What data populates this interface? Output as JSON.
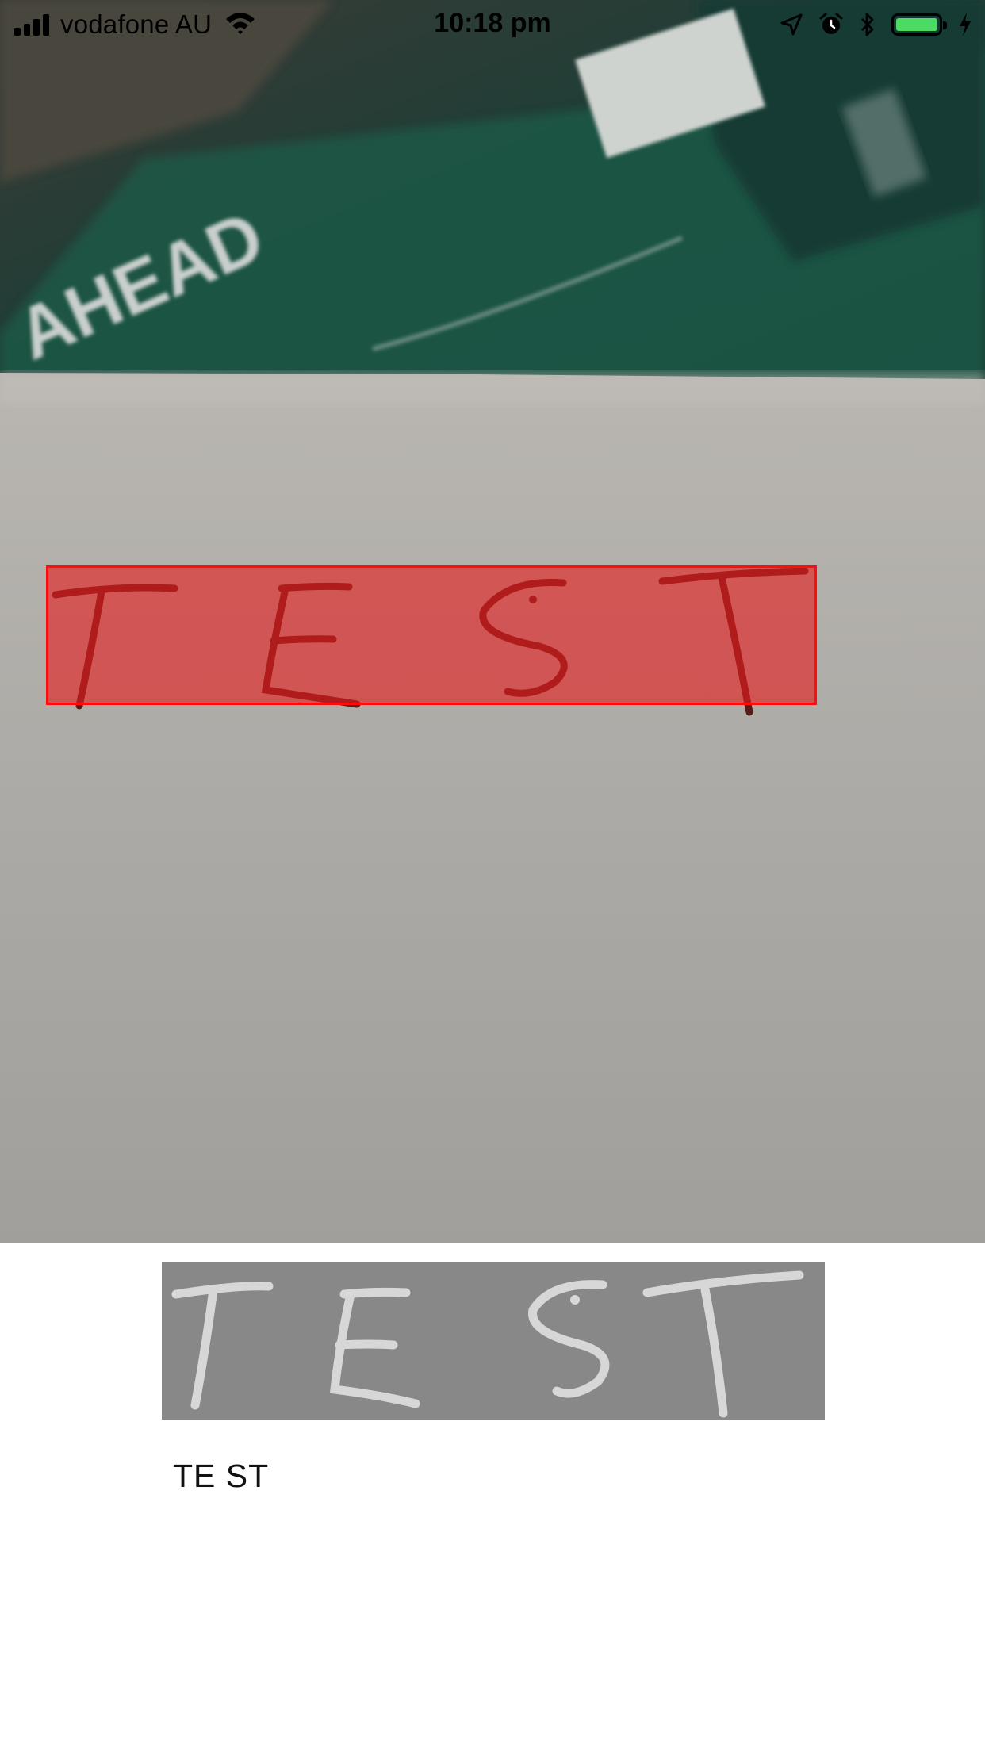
{
  "status_bar": {
    "carrier": "vodafone AU",
    "time": "10:18 pm",
    "signal_bars": 4,
    "battery_level_pct": 100,
    "battery_color": "#4cd964",
    "icons": [
      "signal-icon",
      "wifi-icon",
      "location-arrow-icon",
      "alarm-icon",
      "bluetooth-icon",
      "battery-icon",
      "charging-bolt-icon"
    ]
  },
  "camera_preview": {
    "background_box_text": "AHEAD",
    "handwritten_text": "TEST",
    "detection_box_color": "#ff0d0d"
  },
  "result": {
    "cropped_word_image_text": "TEST",
    "recognized_text": "TE ST"
  }
}
